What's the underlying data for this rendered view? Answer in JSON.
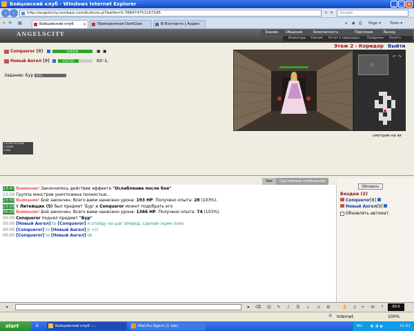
{
  "window": {
    "title": "Бойцовский клуб - Windows Internet Explorer"
  },
  "browser": {
    "url": "http://angelscity.combats.com/buttons.pl?battle=0.788474751167245",
    "search_placeholder": "Google",
    "tabs": [
      {
        "label": "Бойцовский клуб",
        "active": true
      },
      {
        "label": "Прикорочная DarkClan",
        "active": false
      },
      {
        "label": "В Контакте | Аудио",
        "active": false
      }
    ],
    "toolbar": {
      "page": "Page",
      "tools": "Tools"
    }
  },
  "game": {
    "logo": "ANGELSCITY",
    "menu": [
      "Знание",
      "Общение",
      "Безопасность",
      "Персонаж",
      "Выход"
    ],
    "submenu": [
      "Инвентарь",
      "Умения",
      "Отчет о переходах",
      "Поединки",
      "Анкета"
    ],
    "floor": "Этаж 2 - Коридор",
    "exit": "Выйти",
    "view_caption": "смотрим на юг",
    "players": [
      {
        "name": "Conqueror",
        "level": "[8]",
        "hp": "628/628",
        "hp_fraction": 1.0,
        "bar_color": "#29a629"
      },
      {
        "name": "Новый Ангел",
        "level": "[9]",
        "hp": "432/732",
        "hp_fraction": 0.59,
        "bar_color": "#29a629",
        "direction": "Юг-1,"
      }
    ],
    "quest": {
      "label": "Задание: Бур",
      "value": "0/10"
    },
    "counter_lines": [
      "1:40  6479/13364",
      "1  22364",
      "0  628"
    ]
  },
  "chat": {
    "tabs": [
      "Чат",
      "Системные сообщения"
    ],
    "lines": [
      {
        "time": "23:47",
        "hl": true,
        "parts": [
          {
            "t": "Внимание!",
            "c": "warn"
          },
          {
            "t": " Закончилось действие эффекта "
          },
          {
            "t": "\"Ослабление после боя\"",
            "c": "b"
          }
        ]
      },
      {
        "time": "23:50",
        "hl": false,
        "parts": [
          {
            "t": "Группа монстров уничтожена полностью..."
          }
        ]
      },
      {
        "time": "23:55",
        "hl": true,
        "parts": [
          {
            "t": "Внимание!",
            "c": "warn"
          },
          {
            "t": " Бой закончен. Всего вами нанесено урона: "
          },
          {
            "t": "193 HP",
            "c": "b"
          },
          {
            "t": ". Получено опыта: "
          },
          {
            "t": "28",
            "c": "b"
          },
          {
            "t": " (103%)."
          }
        ]
      },
      {
        "time": "23:59",
        "hl": true,
        "parts": [
          {
            "t": "У "
          },
          {
            "t": "Литейщик (5)",
            "c": "b"
          },
          {
            "t": " был предмет 'Бур' и "
          },
          {
            "t": "Conqueror",
            "c": "b"
          },
          {
            "t": " может подобрать его"
          }
        ]
      },
      {
        "time": "00:00",
        "hl": true,
        "parts": [
          {
            "t": "Внимание!",
            "c": "warn"
          },
          {
            "t": " Бой закончен. Всего вами нанесено урона: "
          },
          {
            "t": "1366 HP",
            "c": "b"
          },
          {
            "t": ". Получено опыта: "
          },
          {
            "t": "74",
            "c": "b"
          },
          {
            "t": " (103%)."
          }
        ]
      },
      {
        "time": "00:00",
        "hl": false,
        "parts": [
          {
            "t": "Conqueror",
            "c": "b"
          },
          {
            "t": " поднял предмет "
          },
          {
            "t": "\"Бур\"",
            "c": "b"
          }
        ]
      },
      {
        "time": "00:00",
        "hl": false,
        "parts": [
          {
            "t": "[Новый Ангел]",
            "c": "blue"
          },
          {
            "t": " to ",
            "c": "teal"
          },
          {
            "t": "[Conqueror]",
            "c": "blue"
          },
          {
            "t": " я отойду на шаг вперед. сделай скрин плиз",
            "c": "teal"
          }
        ]
      },
      {
        "time": "00:00",
        "hl": false,
        "parts": [
          {
            "t": "[Conqueror]",
            "c": "blue"
          },
          {
            "t": " to ",
            "c": "teal"
          },
          {
            "t": "[Новый Ангел]",
            "c": "blue"
          },
          {
            "t": " jr =))",
            "c": "teal"
          }
        ]
      },
      {
        "time": "00:00",
        "hl": false,
        "parts": [
          {
            "t": "[Conqueror]",
            "c": "blue"
          },
          {
            "t": " to ",
            "c": "teal"
          },
          {
            "t": "[Новый Ангел]",
            "c": "blue"
          },
          {
            "t": " ok",
            "c": "teal"
          }
        ]
      }
    ]
  },
  "location": {
    "refresh": "Обновить",
    "title": "Бездна (2)",
    "users": [
      {
        "name": "Conqueror",
        "level": "[8]"
      },
      {
        "name": "Новый Ангел",
        "level": "[9]"
      }
    ],
    "auto_label": "Обновлять автомат."
  },
  "clock": {
    "value": "00:0"
  },
  "statusbar": {
    "zone": "Internet",
    "zoom": "100%"
  },
  "taskbar": {
    "start": "start",
    "tasks": [
      "Бойцовский клуб -...",
      "Mail.Ru Agent (1 tab)"
    ],
    "lang": "RU",
    "time": "21:01"
  }
}
